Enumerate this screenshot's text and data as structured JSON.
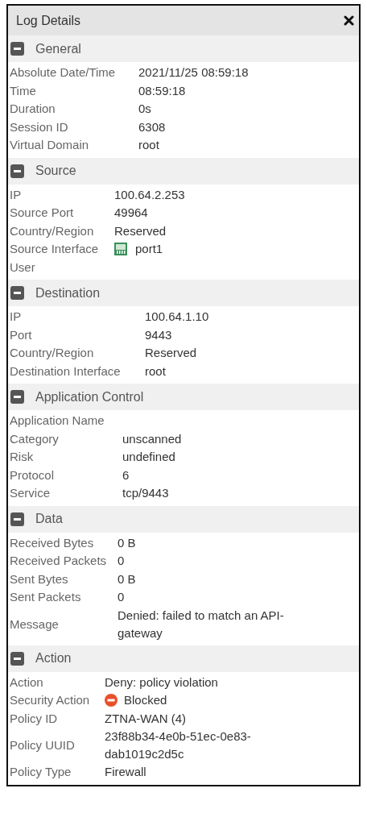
{
  "window": {
    "title": "Log Details"
  },
  "sections": [
    {
      "title": "General",
      "expanded": true,
      "rows": [
        {
          "label": "Absolute Date/Time",
          "value": "2021/11/25 08:59:18",
          "kind": "text"
        },
        {
          "label": "Time",
          "value": "08:59:18",
          "kind": "text"
        },
        {
          "label": "Duration",
          "value": "0s",
          "kind": "text"
        },
        {
          "label": "Session ID",
          "value": "6308",
          "kind": "text"
        },
        {
          "label": "Virtual Domain",
          "value": "root",
          "kind": "text"
        }
      ]
    },
    {
      "title": "Source",
      "expanded": true,
      "rows": [
        {
          "label": "IP",
          "value": "100.64.2.253",
          "kind": "text"
        },
        {
          "label": "Source Port",
          "value": "49964",
          "kind": "text"
        },
        {
          "label": "Country/Region",
          "value": "Reserved",
          "kind": "text"
        },
        {
          "label": "Source Interface",
          "value": "port1",
          "kind": "interface"
        },
        {
          "label": "User",
          "kind": "text"
        }
      ]
    },
    {
      "title": "Destination",
      "expanded": true,
      "rows": [
        {
          "label": "IP",
          "value": "100.64.1.10",
          "kind": "text"
        },
        {
          "label": "Port",
          "value": "9443",
          "kind": "text"
        },
        {
          "label": "Country/Region",
          "value": "Reserved",
          "kind": "text"
        },
        {
          "label": "Destination Interface",
          "value": "root",
          "kind": "text"
        }
      ]
    },
    {
      "title": "Application Control",
      "expanded": true,
      "rows": [
        {
          "label": "Application Name",
          "kind": "text"
        },
        {
          "label": "Category",
          "value": "unscanned",
          "kind": "text"
        },
        {
          "label": "Risk",
          "value": "undefined",
          "kind": "text"
        },
        {
          "label": "Protocol",
          "value": "6",
          "kind": "text"
        },
        {
          "label": "Service",
          "value": "tcp/9443",
          "kind": "text"
        }
      ]
    },
    {
      "title": "Data",
      "expanded": true,
      "rows": [
        {
          "label": "Received Bytes",
          "value": "0 B",
          "kind": "text"
        },
        {
          "label": "Received Packets",
          "value": "0",
          "kind": "text"
        },
        {
          "label": "Sent Bytes",
          "value": "0 B",
          "kind": "text"
        },
        {
          "label": "Sent Packets",
          "value": "0",
          "kind": "text"
        },
        {
          "label": "Message",
          "value": "Denied: failed to match an API-gateway",
          "kind": "text"
        }
      ]
    },
    {
      "title": "Action",
      "expanded": true,
      "rows": [
        {
          "label": "Action",
          "value": "Deny: policy violation",
          "kind": "text"
        },
        {
          "label": "Security Action",
          "value": "Blocked",
          "kind": "blocked"
        },
        {
          "label": "Policy ID",
          "value": "ZTNA-WAN (4)",
          "kind": "text"
        },
        {
          "label": "Policy UUID",
          "value": "23f88b34-4e0b-51ec-0e83-dab1019c2d5c",
          "kind": "text"
        },
        {
          "label": "Policy Type",
          "value": "Firewall",
          "kind": "text"
        }
      ]
    }
  ]
}
